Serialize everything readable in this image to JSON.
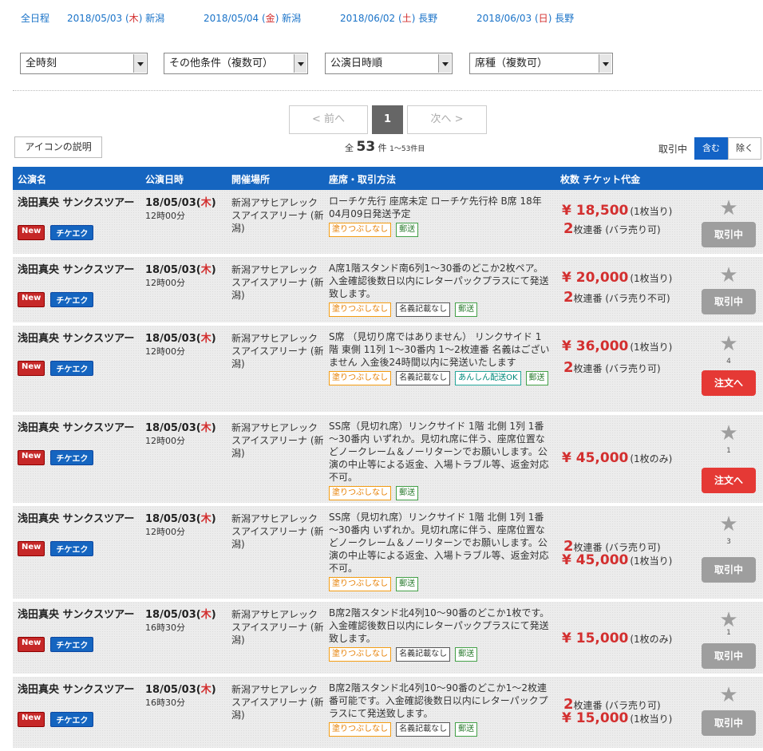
{
  "date_filters": [
    {
      "pre": "全日程",
      "wk": "",
      "post": ""
    },
    {
      "pre": "2018/05/03 (",
      "wk": "木",
      "post": ") 新潟"
    },
    {
      "pre": "2018/05/04 (",
      "wk": "金",
      "post": ") 新潟"
    },
    {
      "pre": "2018/06/02 (",
      "wk": "土",
      "post": ") 長野"
    },
    {
      "pre": "2018/06/03 (",
      "wk": "日",
      "post": ") 長野"
    }
  ],
  "selects": [
    "全時刻",
    "その他条件（複数可）",
    "公演日時順",
    "席種（複数可）"
  ],
  "pager": {
    "prev": "< 前へ",
    "page": "1",
    "next": "次へ >"
  },
  "icon_button": "アイコンの説明",
  "count": {
    "pre": "全",
    "total": "53",
    "unit": "件",
    "range": "1～53件目"
  },
  "filter_toggle": {
    "label": "取引中",
    "on": "含む",
    "off": "除く"
  },
  "columns": {
    "title": "公演名",
    "datetime": "公演日時",
    "venue": "開催場所",
    "seat": "座席・取引方法",
    "qty_price": "枚数 チケット代金"
  },
  "badges": {
    "new": "New",
    "check": "チケエク"
  },
  "rows": [
    {
      "title": "浅田真央 サンクスツアー",
      "date": "18/05/03(",
      "wk": "木",
      "date_end": ")",
      "time": "12時00分",
      "venue": "新潟アサヒアレックスアイスアリーナ (新潟)",
      "desc": "ローチケ先行 座席未定 ローチケ先行枠 B席 18年04月09日発送予定",
      "tags": [
        {
          "t": "塗りつぶしなし",
          "c": "or"
        },
        {
          "t": "郵送",
          "c": "gr"
        }
      ],
      "qty": "2",
      "qty_suffix": "枚連番 (バラ売り可)",
      "price": "¥ 18,500",
      "price_suffix": "(1枚当り)",
      "fav": "",
      "action": "取引中",
      "action_type": "gray"
    },
    {
      "title": "浅田真央 サンクスツアー",
      "date": "18/05/03(",
      "wk": "木",
      "date_end": ")",
      "time": "12時00分",
      "venue": "新潟アサヒアレックスアイスアリーナ (新潟)",
      "desc": "A席1階スタンド南6列1～30番のどこか2枚ペア。入金確認後数日以内にレターパックプラスにて発送致します。",
      "tags": [
        {
          "t": "塗りつぶしなし",
          "c": "or"
        },
        {
          "t": "名義記載なし",
          "c": "bk"
        },
        {
          "t": "郵送",
          "c": "gr"
        }
      ],
      "qty": "2",
      "qty_suffix": "枚連番 (バラ売り不可)",
      "price": "¥ 20,000",
      "price_suffix": "(1枚当り)",
      "fav": "",
      "action": "取引中",
      "action_type": "gray"
    },
    {
      "title": "浅田真央 サンクスツアー",
      "date": "18/05/03(",
      "wk": "木",
      "date_end": ")",
      "time": "12時00分",
      "venue": "新潟アサヒアレックスアイスアリーナ (新潟)",
      "desc": "S席 （見切り席ではありません） リンクサイド 1階 東側 11列 1～30番内 1～2枚連番 名義はございません 入金後24時間以内に発送いたします",
      "tags": [
        {
          "t": "塗りつぶしなし",
          "c": "or"
        },
        {
          "t": "名義記載なし",
          "c": "bk"
        },
        {
          "t": "あんしん配送OK",
          "c": "tl"
        },
        {
          "t": "郵送",
          "c": "gr"
        }
      ],
      "qty": "2",
      "qty_suffix": "枚連番 (バラ売り可)",
      "price": "¥ 36,000",
      "price_suffix": "(1枚当り)",
      "fav": "4",
      "action": "注文へ",
      "action_type": "red"
    },
    {
      "title": "浅田真央 サンクスツアー",
      "date": "18/05/03(",
      "wk": "木",
      "date_end": ")",
      "time": "12時00分",
      "venue": "新潟アサヒアレックスアイスアリーナ (新潟)",
      "desc": "SS席（見切れ席）リンクサイド 1階 北側 1列 1番～30番内 いずれか。見切れ席に伴う、座席位置などノークレーム＆ノーリターンでお願いします。公演の中止等による返金、入場トラブル等、返金対応不可。",
      "tags": [
        {
          "t": "塗りつぶしなし",
          "c": "or"
        },
        {
          "t": "郵送",
          "c": "gr"
        }
      ],
      "qty": "",
      "qty_suffix": "",
      "price": "¥ 45,000",
      "price_suffix": "(1枚のみ)",
      "fav": "1",
      "action": "注文へ",
      "action_type": "red"
    },
    {
      "title": "浅田真央 サンクスツアー",
      "date": "18/05/03(",
      "wk": "木",
      "date_end": ")",
      "time": "12時00分",
      "venue": "新潟アサヒアレックスアイスアリーナ (新潟)",
      "desc": "SS席（見切れ席）リンクサイド 1階 北側 1列 1番～30番内 いずれか。見切れ席に伴う、座席位置などノークレーム＆ノーリターンでお願いします。公演の中止等による返金、入場トラブル等、返金対応不可。",
      "tags": [
        {
          "t": "塗りつぶしなし",
          "c": "or"
        },
        {
          "t": "郵送",
          "c": "gr"
        }
      ],
      "qty": "2",
      "qty_suffix": "枚連番 (バラ売り可)",
      "price": "¥ 45,000",
      "price_suffix": "(1枚当り)",
      "fav": "3",
      "action": "取引中",
      "action_type": "gray"
    },
    {
      "title": "浅田真央 サンクスツアー",
      "date": "18/05/03(",
      "wk": "木",
      "date_end": ")",
      "time": "16時30分",
      "venue": "新潟アサヒアレックスアイスアリーナ (新潟)",
      "desc": "B席2階スタンド北4列10～90番のどこか1枚です。入金確認後数日以内にレターパックプラスにて発送致します。",
      "tags": [
        {
          "t": "塗りつぶしなし",
          "c": "or"
        },
        {
          "t": "名義記載なし",
          "c": "bk"
        },
        {
          "t": "郵送",
          "c": "gr"
        }
      ],
      "qty": "",
      "qty_suffix": "",
      "price": "¥ 15,000",
      "price_suffix": "(1枚のみ)",
      "fav": "1",
      "action": "取引中",
      "action_type": "gray"
    },
    {
      "title": "浅田真央 サンクスツアー",
      "date": "18/05/03(",
      "wk": "木",
      "date_end": ")",
      "time": "16時30分",
      "venue": "新潟アサヒアレックスアイスアリーナ (新潟)",
      "desc": "B席2階スタンド北4列10～90番のどこか1～2枚連番可能です。入金確認後数日以内にレターパックプラスにて発送致します。",
      "tags": [
        {
          "t": "塗りつぶしなし",
          "c": "or"
        },
        {
          "t": "名義記載なし",
          "c": "bk"
        },
        {
          "t": "郵送",
          "c": "gr"
        }
      ],
      "qty": "2",
      "qty_suffix": "枚連番 (バラ売り可)",
      "price": "¥ 15,000",
      "price_suffix": "(1枚当り)",
      "fav": "",
      "action": "取引中",
      "action_type": "gray"
    }
  ],
  "colors": {
    "header": "#1565c0",
    "accent_red": "#d32f2f",
    "link": "#1a73c8",
    "button_gray": "#9e9e9e",
    "button_red": "#e53935"
  },
  "icons": {
    "favorite": "star-icon",
    "select_arrow": "chevron-down-icon"
  }
}
